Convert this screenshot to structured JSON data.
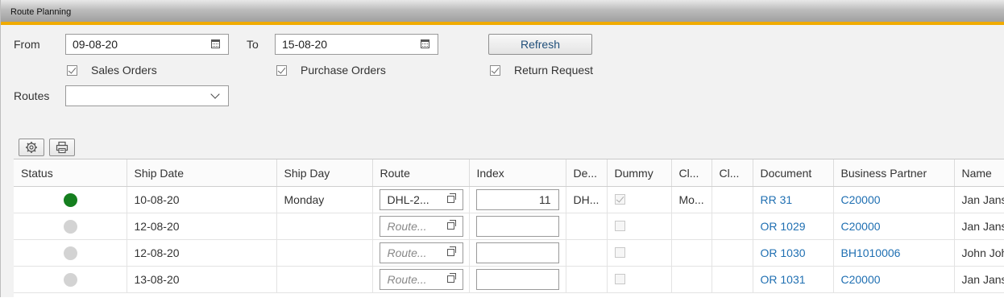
{
  "window": {
    "title": "Route Planning"
  },
  "filters": {
    "from_label": "From",
    "from_value": "09-08-20",
    "to_label": "To",
    "to_value": "15-08-20",
    "refresh_label": "Refresh",
    "sales_orders_label": "Sales Orders",
    "sales_orders_checked": true,
    "purchase_orders_label": "Purchase Orders",
    "purchase_orders_checked": true,
    "return_request_label": "Return Request",
    "return_request_checked": true,
    "routes_label": "Routes",
    "routes_value": ""
  },
  "toolbar": {
    "settings_icon": "gear-icon",
    "print_icon": "printer-icon"
  },
  "grid": {
    "columns": [
      "Status",
      "Ship Date",
      "Ship Day",
      "Route",
      "Index",
      "De...",
      "Dummy",
      "Cl...",
      "Cl...",
      "Document",
      "Business Partner",
      "Name"
    ],
    "route_placeholder": "Route...",
    "rows": [
      {
        "status": "green",
        "ship_date": "10-08-20",
        "ship_day": "Monday",
        "route": "DHL-2...",
        "index": "11",
        "de": "DH...",
        "dummy": true,
        "cl1": "Mo...",
        "cl2": "",
        "document": "RR 31",
        "bp": "C20000",
        "name": "Jan Jansen"
      },
      {
        "status": "grey",
        "ship_date": "12-08-20",
        "ship_day": "",
        "route": "",
        "index": "",
        "de": "",
        "dummy": false,
        "cl1": "",
        "cl2": "",
        "document": "OR 1029",
        "bp": "C20000",
        "name": "Jan Jansen"
      },
      {
        "status": "grey",
        "ship_date": "12-08-20",
        "ship_day": "",
        "route": "",
        "index": "",
        "de": "",
        "dummy": false,
        "cl1": "",
        "cl2": "",
        "document": "OR 1030",
        "bp": "BH1010006",
        "name": "John Johnson"
      },
      {
        "status": "grey",
        "ship_date": "13-08-20",
        "ship_day": "",
        "route": "",
        "index": "",
        "de": "",
        "dummy": false,
        "cl1": "",
        "cl2": "",
        "document": "OR 1031",
        "bp": "C20000",
        "name": "Jan Jansen"
      }
    ]
  },
  "colors": {
    "accent": "#f0ab00",
    "link": "#1f6fb2",
    "status_green": "#157f1f",
    "status_grey": "#d3d3d3"
  }
}
